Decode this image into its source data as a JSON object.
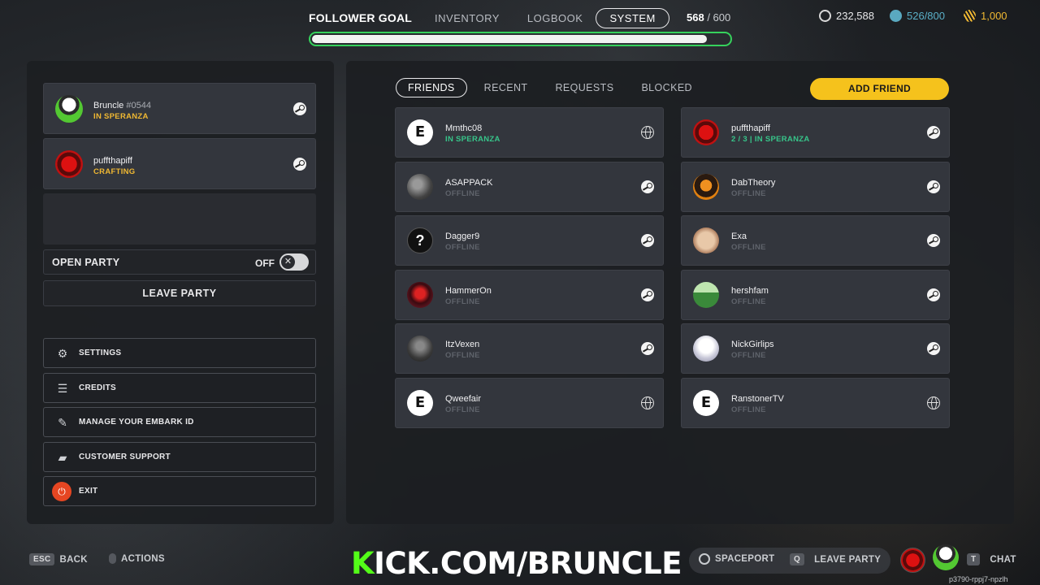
{
  "topbar": {
    "goal_label": "FOLLOWER GOAL",
    "tabs": [
      "INVENTORY",
      "LOGBOOK",
      "SYSTEM"
    ],
    "active_tab": "SYSTEM",
    "goal_current": "568",
    "goal_total": "/ 600",
    "goal_progress": 0.947
  },
  "currency": {
    "coins": "232,588",
    "tokens": "526/800",
    "other": "1,000"
  },
  "party": {
    "members": [
      {
        "name": "Bruncle",
        "tag": "#0544",
        "status": "IN SPERANZA",
        "avatar": "bruncle-avatar",
        "platform": "steam-icon"
      },
      {
        "name": "puffthapiff",
        "tag": "",
        "status": "CRAFTING",
        "avatar": "red-emblem-avatar",
        "platform": "steam-icon"
      }
    ],
    "open_party_label": "OPEN PARTY",
    "open_party_state": "OFF",
    "leave_party_label": "LEAVE PARTY"
  },
  "menu": [
    {
      "label": "SETTINGS",
      "icon": "gear-icon"
    },
    {
      "label": "CREDITS",
      "icon": "credits-icon"
    },
    {
      "label": "MANAGE YOUR EMBARK ID",
      "icon": "edit-icon"
    },
    {
      "label": "CUSTOMER SUPPORT",
      "icon": "support-icon"
    },
    {
      "label": "EXIT",
      "icon": "power-icon"
    }
  ],
  "friends_panel": {
    "tabs": [
      "FRIENDS",
      "RECENT",
      "REQUESTS",
      "BLOCKED"
    ],
    "active_tab": "FRIENDS",
    "add_friend_label": "ADD FRIEND",
    "friends": [
      {
        "name": "Mmthc08",
        "status": "IN SPERANZA",
        "online": true,
        "platform": "globe-icon",
        "avatar": "embark"
      },
      {
        "name": "puffthapiff",
        "status": "2 / 3 | IN SPERANZA",
        "online": true,
        "platform": "steam-icon",
        "avatar": "red"
      },
      {
        "name": "ASAPPACK",
        "status": "OFFLINE",
        "online": false,
        "platform": "steam-icon",
        "avatar": "gray"
      },
      {
        "name": "DabTheory",
        "status": "OFFLINE",
        "online": false,
        "platform": "steam-icon",
        "avatar": "orange"
      },
      {
        "name": "Dagger9",
        "status": "OFFLINE",
        "online": false,
        "platform": "steam-icon",
        "avatar": "question"
      },
      {
        "name": "Exa",
        "status": "OFFLINE",
        "online": false,
        "platform": "steam-icon",
        "avatar": "tan"
      },
      {
        "name": "HammerOn",
        "status": "OFFLINE",
        "online": false,
        "platform": "steam-icon",
        "avatar": "crimson"
      },
      {
        "name": "hershfam",
        "status": "OFFLINE",
        "online": false,
        "platform": "steam-icon",
        "avatar": "green"
      },
      {
        "name": "ItzVexen",
        "status": "OFFLINE",
        "online": false,
        "platform": "steam-icon",
        "avatar": "darkgray"
      },
      {
        "name": "NickGirlips",
        "status": "OFFLINE",
        "online": false,
        "platform": "steam-icon",
        "avatar": "white"
      },
      {
        "name": "Qweefair",
        "status": "OFFLINE",
        "online": false,
        "platform": "globe-icon",
        "avatar": "embark"
      },
      {
        "name": "RanstonerTV",
        "status": "OFFLINE",
        "online": false,
        "platform": "globe-icon",
        "avatar": "embark"
      }
    ]
  },
  "bottom": {
    "back_key": "ESC",
    "back_label": "BACK",
    "actions_label": "ACTIONS",
    "kick_k": "K",
    "kick_rest": "ICK.COM/BRUNCLE",
    "spaceport_label": "SPACEPORT",
    "leave_key": "Q",
    "leave_label": "LEAVE PARTY",
    "chat_key": "T",
    "chat_label": "CHAT",
    "embark_id": "p3790-rppj7-npzlh"
  },
  "colors": {
    "accent_green": "#36d15c",
    "status_yellow": "#f0b832",
    "status_online": "#37c58a",
    "add_friend_bg": "#f5c21c",
    "exit_red": "#e64622",
    "kick_green": "#53fc18"
  }
}
